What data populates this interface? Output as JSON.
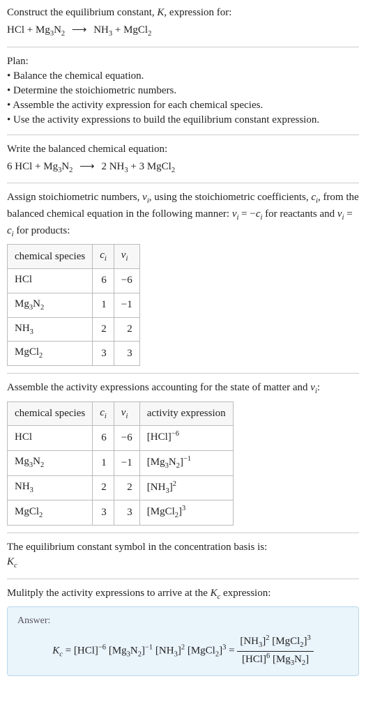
{
  "header": {
    "prompt": "Construct the equilibrium constant, ",
    "kvar": "K",
    "prompt2": ", expression for:"
  },
  "unbalanced": {
    "lhs1": "HCl",
    "lhs2": "Mg",
    "lhs2_sub1": "3",
    "lhs2b": "N",
    "lhs2_sub2": "2",
    "rhs1": "NH",
    "rhs1_sub": "3",
    "rhs2": "MgCl",
    "rhs2_sub": "2"
  },
  "plan": {
    "title": "Plan:",
    "items": [
      "Balance the chemical equation.",
      "Determine the stoichiometric numbers.",
      "Assemble the activity expression for each chemical species.",
      "Use the activity expressions to build the equilibrium constant expression."
    ]
  },
  "balanced": {
    "intro": "Write the balanced chemical equation:",
    "c1": "6",
    "s1": "HCl",
    "s2a": "Mg",
    "s2sub1": "3",
    "s2b": "N",
    "s2sub2": "2",
    "c3": "2",
    "s3": "NH",
    "s3sub": "3",
    "c4": "3",
    "s4": "MgCl",
    "s4sub": "2"
  },
  "stoich": {
    "intro1": "Assign stoichiometric numbers, ",
    "nu": "ν",
    "sub_i": "i",
    "intro2": ", using the stoichiometric coefficients, ",
    "c": "c",
    "intro3": ", from the balanced chemical equation in the following manner: ",
    "rel_reactants": " = −",
    "intro4": " for reactants and ",
    "rel_products": " = ",
    "intro5": " for products:",
    "headers": {
      "species": "chemical species",
      "ci": "c",
      "nui": "ν"
    },
    "rows": [
      {
        "species_a": "HCl",
        "species_sub1": "",
        "species_b": "",
        "species_sub2": "",
        "ci": "6",
        "nui": "−6"
      },
      {
        "species_a": "Mg",
        "species_sub1": "3",
        "species_b": "N",
        "species_sub2": "2",
        "ci": "1",
        "nui": "−1"
      },
      {
        "species_a": "NH",
        "species_sub1": "3",
        "species_b": "",
        "species_sub2": "",
        "ci": "2",
        "nui": "2"
      },
      {
        "species_a": "MgCl",
        "species_sub1": "2",
        "species_b": "",
        "species_sub2": "",
        "ci": "3",
        "nui": "3"
      }
    ]
  },
  "activity": {
    "intro1": "Assemble the activity expressions accounting for the state of matter and ",
    "intro2": ":",
    "headers": {
      "species": "chemical species",
      "ci": "c",
      "nui": "ν",
      "act": "activity expression"
    },
    "rows": [
      {
        "species_a": "HCl",
        "species_sub1": "",
        "species_b": "",
        "species_sub2": "",
        "ci": "6",
        "nui": "−6",
        "act_inner": "HCl",
        "act_sub1": "",
        "act_b": "",
        "act_sub2": "",
        "act_exp": "−6"
      },
      {
        "species_a": "Mg",
        "species_sub1": "3",
        "species_b": "N",
        "species_sub2": "2",
        "ci": "1",
        "nui": "−1",
        "act_inner": "Mg",
        "act_sub1": "3",
        "act_b": "N",
        "act_sub2": "2",
        "act_exp": "−1"
      },
      {
        "species_a": "NH",
        "species_sub1": "3",
        "species_b": "",
        "species_sub2": "",
        "ci": "2",
        "nui": "2",
        "act_inner": "NH",
        "act_sub1": "3",
        "act_b": "",
        "act_sub2": "",
        "act_exp": "2"
      },
      {
        "species_a": "MgCl",
        "species_sub1": "2",
        "species_b": "",
        "species_sub2": "",
        "ci": "3",
        "nui": "3",
        "act_inner": "MgCl",
        "act_sub1": "2",
        "act_b": "",
        "act_sub2": "",
        "act_exp": "3"
      }
    ]
  },
  "basis": {
    "line1": "The equilibrium constant symbol in the concentration basis is:",
    "symbol": "K",
    "symbol_sub": "c"
  },
  "final": {
    "intro": "Mulitply the activity expressions to arrive at the ",
    "kc": "K",
    "kc_sub": "c",
    "intro2": " expression:",
    "answer_label": "Answer:",
    "kc_eq": " = ",
    "t1": "HCl",
    "t1exp": "−6",
    "t2a": "Mg",
    "t2s1": "3",
    "t2b": "N",
    "t2s2": "2",
    "t2exp": "−1",
    "t3": "NH",
    "t3s": "3",
    "t3exp": "2",
    "t4": "MgCl",
    "t4s": "2",
    "t4exp": "3",
    "eq2": " = ",
    "num_t1": "NH",
    "num_t1s": "3",
    "num_t1exp": "2",
    "num_t2": "MgCl",
    "num_t2s": "2",
    "num_t2exp": "3",
    "den_t1": "HCl",
    "den_t1exp": "6",
    "den_t2a": "Mg",
    "den_t2s1": "3",
    "den_t2b": "N",
    "den_t2s2": "2"
  }
}
